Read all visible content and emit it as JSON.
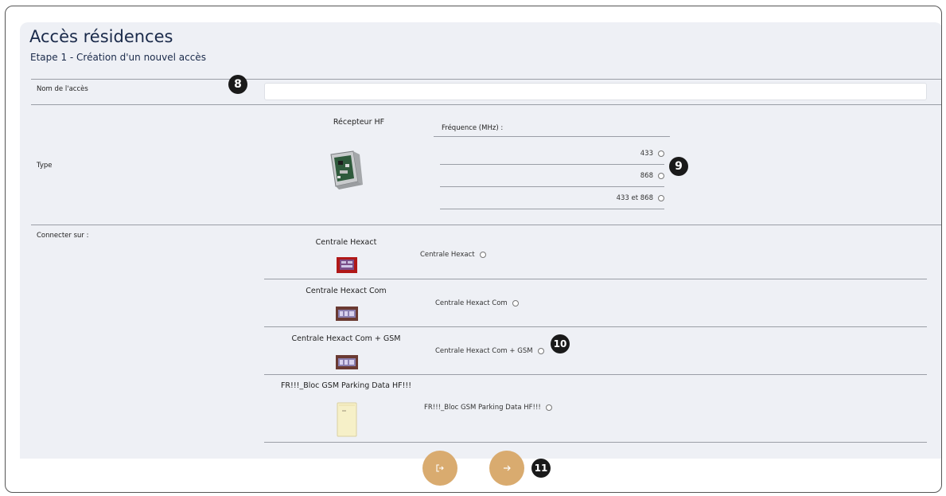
{
  "page": {
    "title": "Accès résidences",
    "subtitle": "Etape 1 - Création d'un nouvel accès"
  },
  "form": {
    "name_label": "Nom de l'accès",
    "name_value": "",
    "type_label": "Type",
    "receiver_title": "Récepteur HF",
    "frequency_title": "Fréquence (MHz) :",
    "frequencies": [
      "433",
      "868",
      "433 et 868"
    ],
    "connect_label": "Connecter sur :",
    "devices": [
      {
        "title": "Centrale Hexact",
        "option": "Centrale Hexact"
      },
      {
        "title": "Centrale Hexact Com",
        "option": "Centrale Hexact Com"
      },
      {
        "title": "Centrale Hexact Com + GSM",
        "option": "Centrale Hexact Com + GSM"
      },
      {
        "title": "FR!!!_Bloc GSM Parking Data HF!!!",
        "option": "FR!!!_Bloc GSM Parking Data HF!!!"
      }
    ]
  },
  "badges": [
    "8",
    "9",
    "10",
    "11"
  ],
  "buttons": {
    "exit_icon": "exit-icon",
    "next_icon": "arrow-right-icon"
  },
  "colors": {
    "accent": "#d9ab6f",
    "panel": "#eef0f5",
    "title": "#1a2a4a"
  }
}
